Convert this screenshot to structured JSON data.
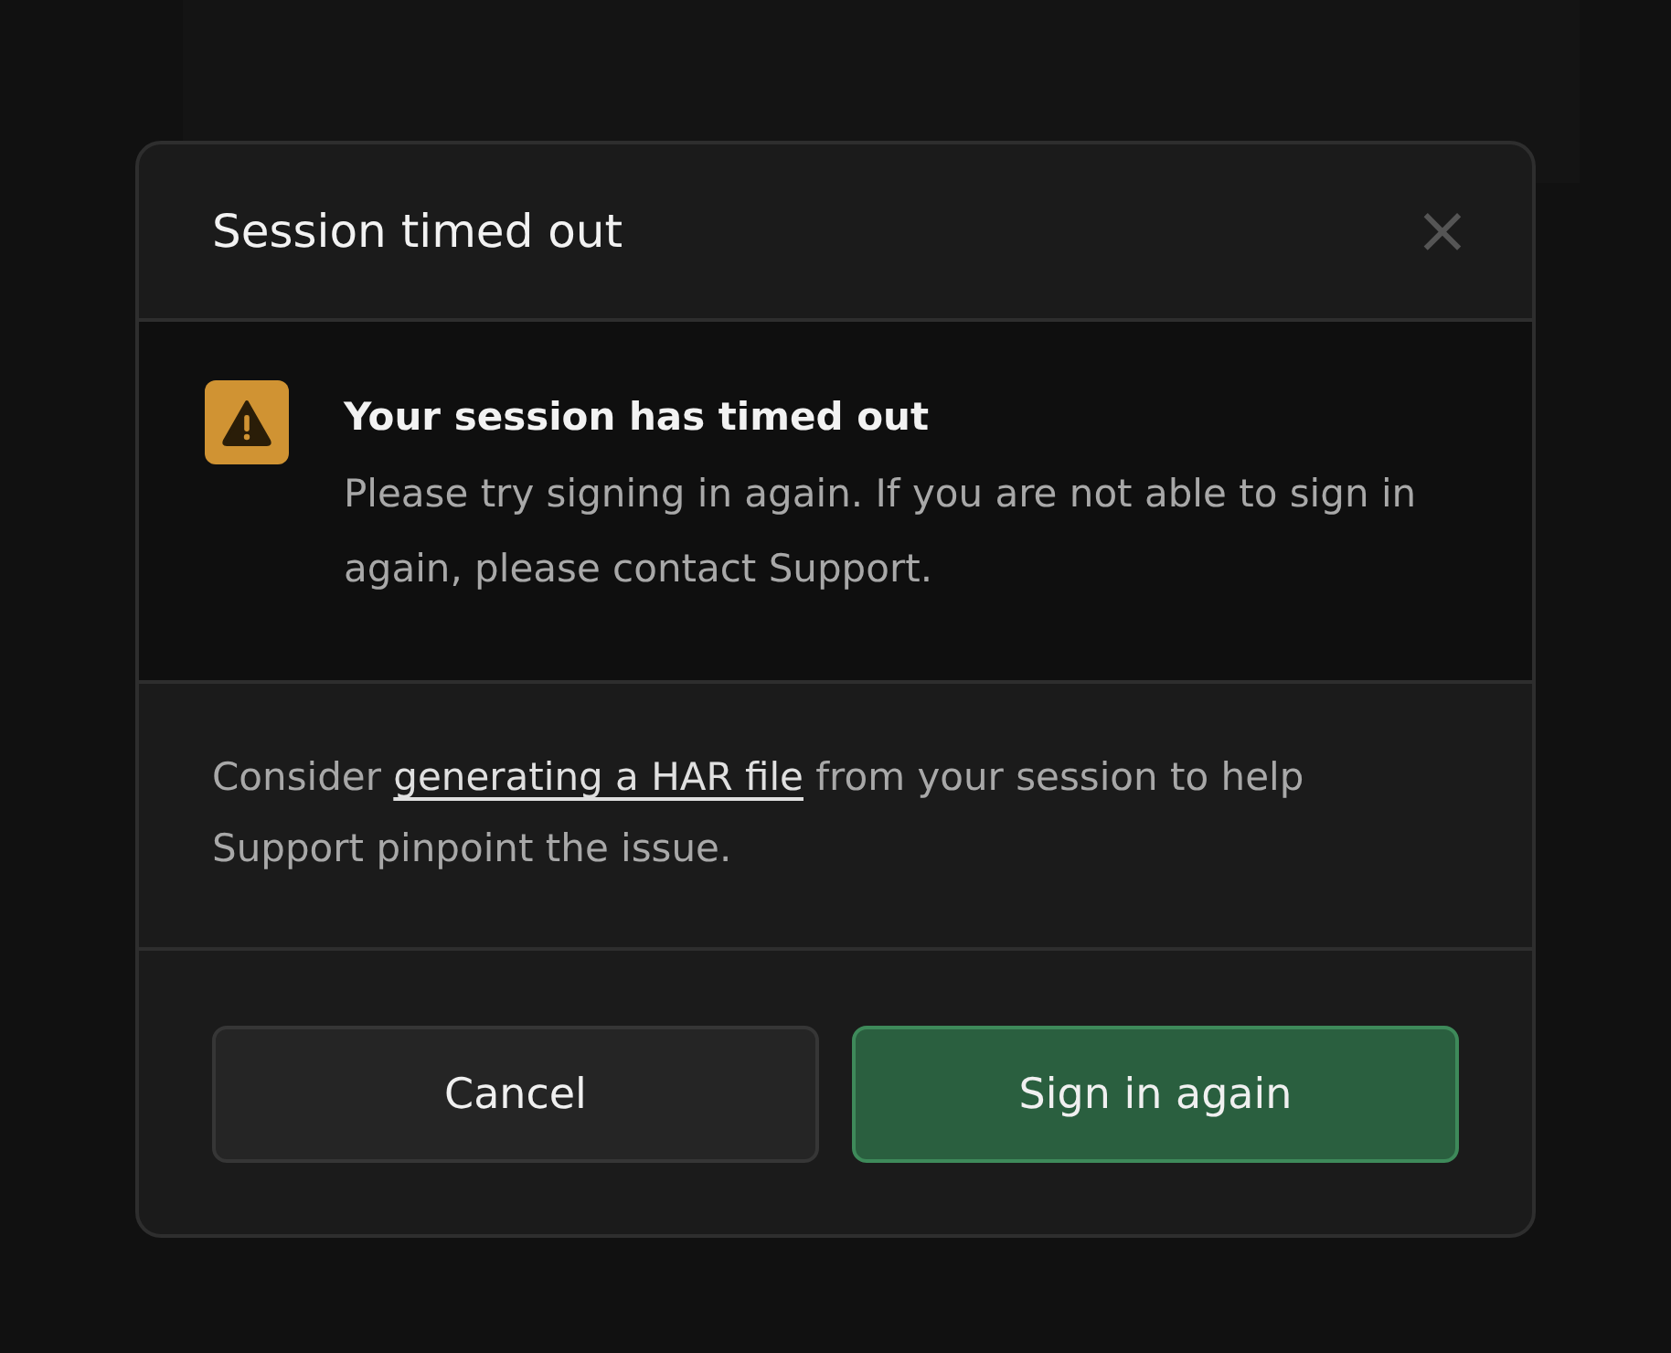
{
  "dialog": {
    "title": "Session timed out",
    "close": "×",
    "alert": {
      "kind": "warning",
      "title": "Your session has timed out",
      "message": "Please try signing in again. If you are not able to sign in again, please contact Support."
    },
    "note": {
      "before": "Consider ",
      "link": "generating a HAR file",
      "after": " from your session to help Support pinpoint the issue."
    },
    "buttons": [
      {
        "label": "Cancel",
        "kind": "secondary"
      },
      {
        "label": "Sign in again",
        "kind": "primary"
      }
    ]
  }
}
